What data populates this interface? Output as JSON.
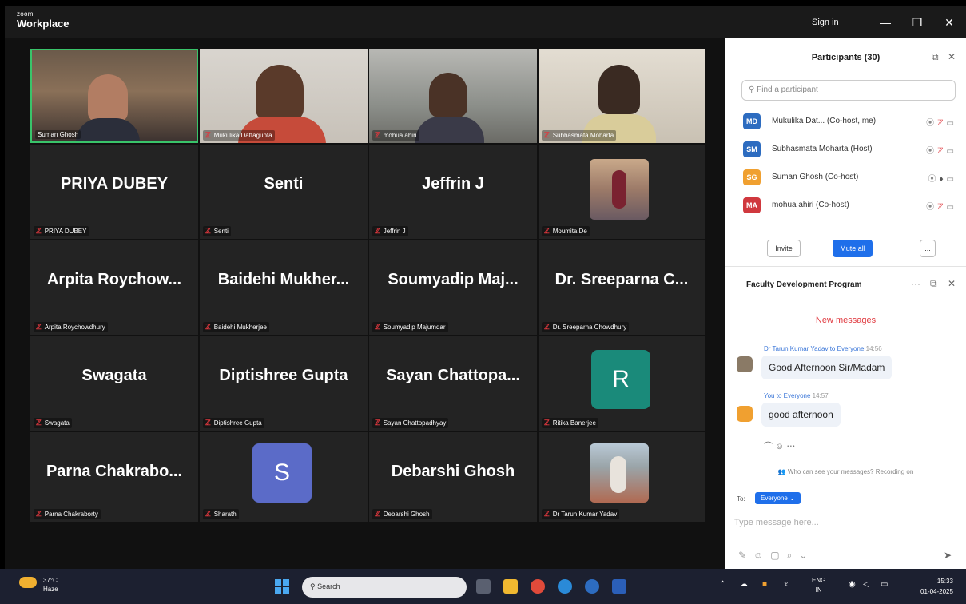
{
  "app": {
    "brand_small": "zoom",
    "brand_name": "Workplace",
    "signin_label": "Sign in"
  },
  "gallery": {
    "video_tiles": [
      {
        "name": "Suman Ghosh",
        "active": true
      },
      {
        "name": "Mukulika Dattagupta"
      },
      {
        "name": "mohua ahiri"
      },
      {
        "name": "Subhasmata Moharta"
      }
    ],
    "tiles": [
      {
        "big": "PRIYA DUBEY",
        "small": "PRIYA DUBEY"
      },
      {
        "big": "Senti",
        "small": "Senti"
      },
      {
        "big": "Jeffrin J",
        "small": "Jeffrin J"
      },
      {
        "small": "Moumita De"
      },
      {
        "big": "Arpita Roychow...",
        "small": "Arpita Roychowdhury"
      },
      {
        "big": "Baidehi Mukher...",
        "small": "Baidehi Mukherjee"
      },
      {
        "big": "Soumyadip Maj...",
        "small": "Soumyadip Majumdar"
      },
      {
        "big": "Dr. Sreeparna C...",
        "small": "Dr. Sreeparna Chowdhury"
      },
      {
        "big": "Swagata",
        "small": "Swagata"
      },
      {
        "big": "Diptishree Gupta",
        "small": "Diptishree Gupta"
      },
      {
        "big": "Sayan Chattopa...",
        "small": "Sayan Chattopadhyay"
      },
      {
        "avatar_letter": "R",
        "avatar_color": "#1a8a7a",
        "small": "Ritika Banerjee"
      },
      {
        "big": "Parna Chakrabo...",
        "small": "Parna Chakraborty"
      },
      {
        "avatar_letter": "S",
        "avatar_color": "#5b6bc8",
        "small": "Sharath"
      },
      {
        "big": "Debarshi Ghosh",
        "small": "Debarshi Ghosh"
      },
      {
        "small": "Dr Tarun Kumar Yadav"
      }
    ]
  },
  "participants": {
    "title": "Participants (30)",
    "search_placeholder": "Find a participant",
    "list": [
      {
        "initials": "MD",
        "color": "#2d6cc0",
        "name": "Mukulika Dat... (Co-host, me)"
      },
      {
        "initials": "SM",
        "color": "#2d6cc0",
        "name": "Subhasmata Moharta (Host)"
      },
      {
        "initials": "SG",
        "color": "#f0a030",
        "name": "Suman Ghosh (Co-host)"
      },
      {
        "initials": "MA",
        "color": "#d0383e",
        "name": "mohua ahiri (Co-host)"
      }
    ],
    "invite_label": "Invite",
    "mute_all_label": "Mute all",
    "more_label": "..."
  },
  "chat": {
    "title": "Faculty Development Program",
    "new_messages": "New messages",
    "messages": [
      {
        "sender": "Dr Tarun Kumar Yadav to Everyone",
        "time": "14:56",
        "text": "Good Afternoon Sir/Madam"
      },
      {
        "sender": "You to Everyone",
        "time": "14:57",
        "text": "good afternoon"
      }
    ],
    "who_can_see": "Who can see your messages? Recording on",
    "to_label": "To:",
    "recipient": "Everyone",
    "input_placeholder": "Type message here..."
  },
  "taskbar": {
    "temp": "37°C",
    "weather": "Haze",
    "search_placeholder": "Search",
    "lang_1": "ENG",
    "lang_2": "IN",
    "time": "15:33",
    "date": "01-04-2025"
  }
}
